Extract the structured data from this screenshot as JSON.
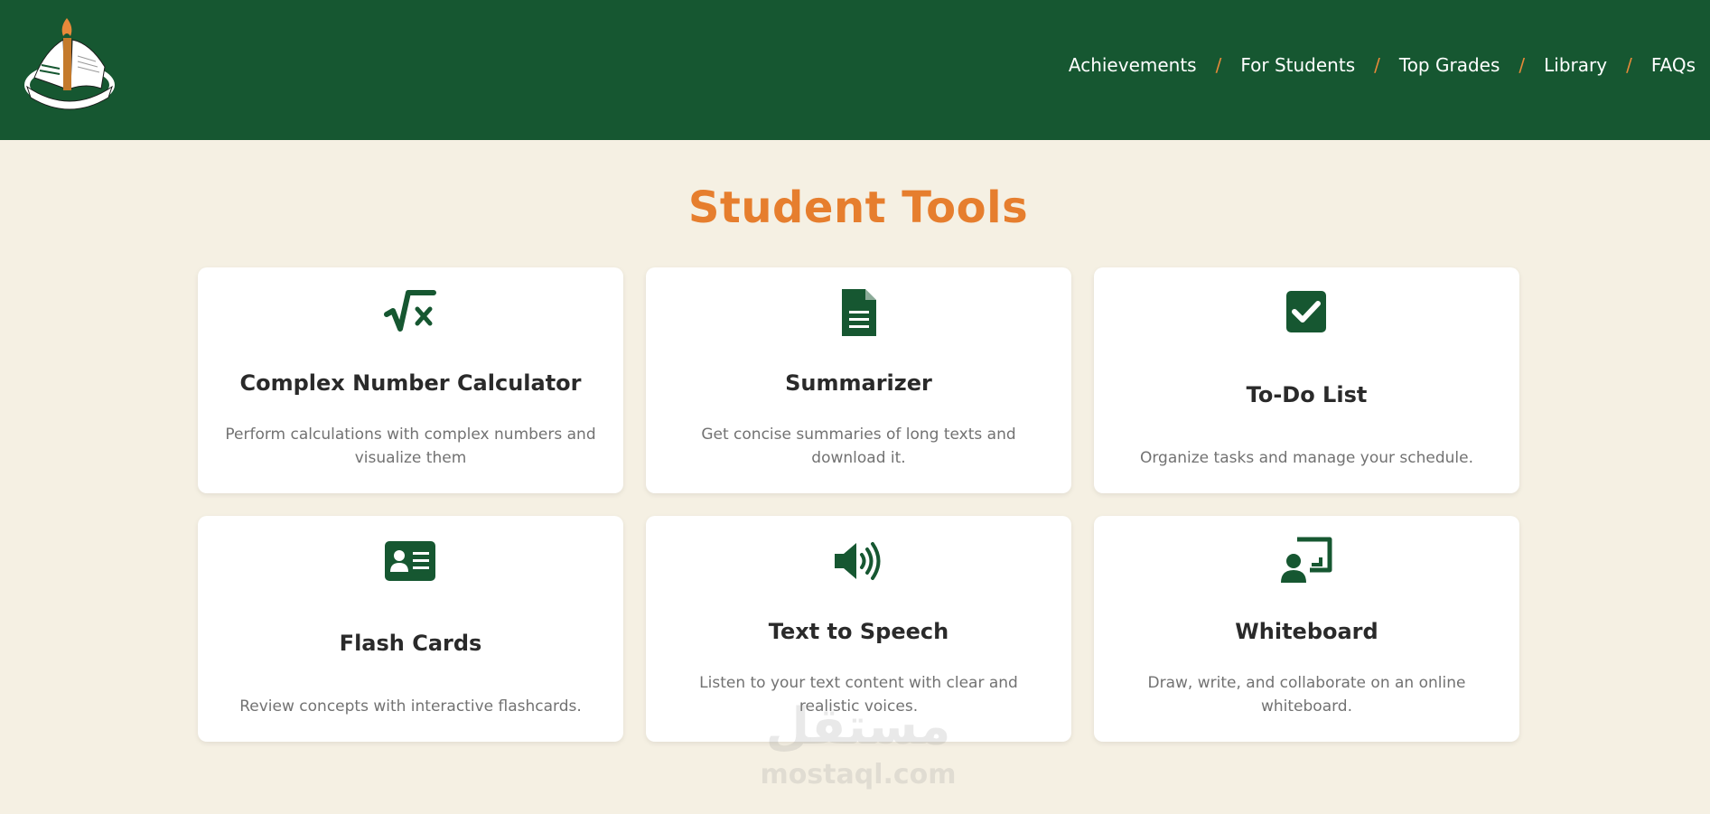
{
  "header": {
    "logo_icon": "school-emblem-icon",
    "nav": [
      {
        "label": "Achievements"
      },
      {
        "label": "For Students"
      },
      {
        "label": "Top Grades"
      },
      {
        "label": "Library"
      },
      {
        "label": "FAQs"
      }
    ],
    "separator": "/"
  },
  "page": {
    "title": "Student Tools"
  },
  "tools": [
    {
      "icon": "square-root-icon",
      "title": "Complex Number Calculator",
      "description": "Perform calculations with complex numbers and visualize them"
    },
    {
      "icon": "document-icon",
      "title": "Summarizer",
      "description": "Get concise summaries of long texts and download it."
    },
    {
      "icon": "checkbox-icon",
      "title": "To-Do List",
      "description": "Organize tasks and manage your schedule."
    },
    {
      "icon": "id-card-icon",
      "title": "Flash Cards",
      "description": "Review concepts with interactive flashcards."
    },
    {
      "icon": "speaker-icon",
      "title": "Text to Speech",
      "description": "Listen to your text content with clear and realistic voices."
    },
    {
      "icon": "whiteboard-icon",
      "title": "Whiteboard",
      "description": "Draw, write, and collaborate on an online whiteboard."
    }
  ],
  "watermark": {
    "arabic": "مستقل",
    "latin": "mostaql.com"
  },
  "colors": {
    "header_bg": "#165731",
    "accent": "#e67e2e",
    "icon": "#165731",
    "page_bg": "#f5f0e3"
  }
}
